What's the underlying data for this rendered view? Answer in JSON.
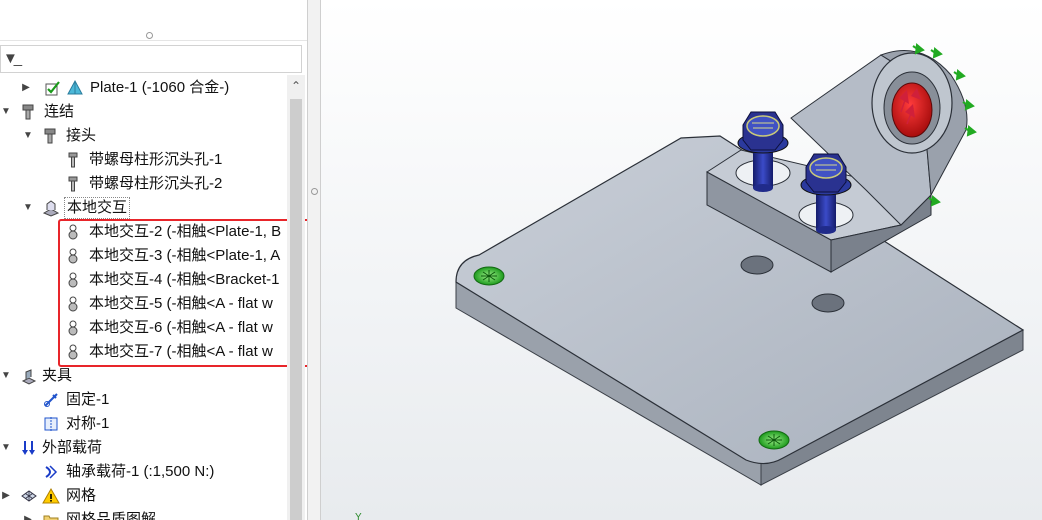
{
  "tree": {
    "part_plate": "Plate-1 (-1060 合金-)",
    "connections": "连结",
    "bolts": "接头",
    "bolt_1": "带螺母柱形沉头孔-1",
    "bolt_2": "带螺母柱形沉头孔-2",
    "local_interactions": "本地交互",
    "interaction_2": "本地交互-2 (-相触<Plate-1, B",
    "interaction_3": "本地交互-3 (-相触<Plate-1, A",
    "interaction_4": "本地交互-4 (-相触<Bracket-1",
    "interaction_5": "本地交互-5 (-相触<A - flat w",
    "interaction_6": "本地交互-6 (-相触<A - flat w",
    "interaction_7": "本地交互-7 (-相触<A - flat w",
    "fixtures": "夹具",
    "fixed_1": "固定-1",
    "symmetry_1": "对称-1",
    "external_loads": "外部载荷",
    "bearing_load_1": "轴承载荷-1 (:1,500 N:)",
    "mesh": "网格",
    "mesh_quality": "网格品质图解"
  },
  "viewport": {
    "triad_label": "Y"
  },
  "colors": {
    "highlight_box": "#e8252a",
    "plate": "#b8c0cc",
    "bolt": "#1e2a8c",
    "load_arrow": "#cc1a1a",
    "fixture_marker": "#22b022"
  }
}
